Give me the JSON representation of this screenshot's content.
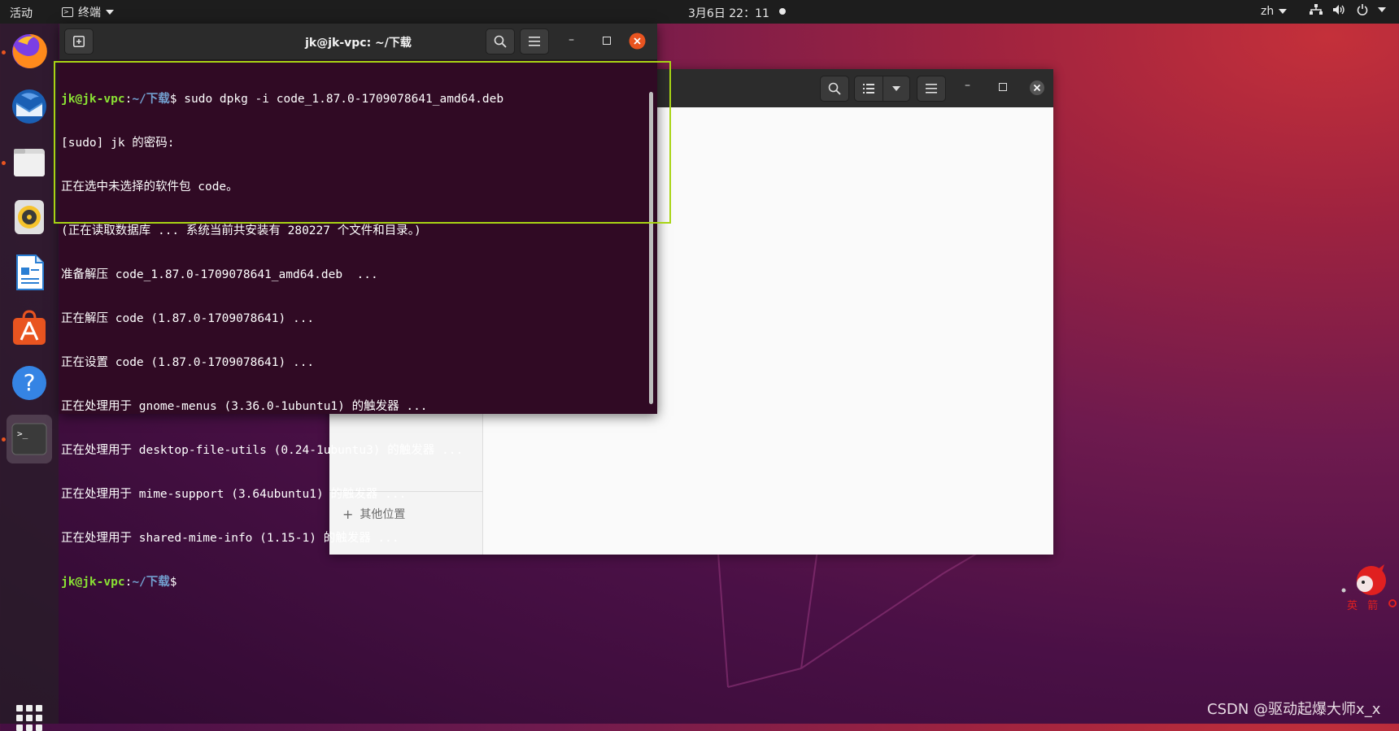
{
  "topbar": {
    "activities": "活动",
    "app_name": "终端",
    "clock": "3月6日  22：11",
    "language": "zh"
  },
  "dock": {
    "items": [
      {
        "name": "firefox",
        "running": true
      },
      {
        "name": "thunderbird",
        "running": false
      },
      {
        "name": "files",
        "running": true
      },
      {
        "name": "rhythmbox",
        "running": false
      },
      {
        "name": "libreoffice-writer",
        "running": false
      },
      {
        "name": "ubuntu-software",
        "running": false
      },
      {
        "name": "help",
        "running": false
      },
      {
        "name": "terminal",
        "running": true
      }
    ]
  },
  "terminal": {
    "title": "jk@jk-vpc: ~/下载",
    "prompt_user": "jk@jk-vpc",
    "prompt_path": "~/下载",
    "command": "sudo dpkg -i code_1.87.0-1709078641_amd64.deb",
    "output": [
      "[sudo] jk 的密码:",
      "正在选中未选择的软件包 code。",
      "(正在读取数据库 ... 系统当前共安装有 280227 个文件和目录。)",
      "准备解压 code_1.87.0-1709078641_amd64.deb  ...",
      "正在解压 code (1.87.0-1709078641) ...",
      "正在设置 code (1.87.0-1709078641) ...",
      "正在处理用于 gnome-menus (3.36.0-1ubuntu1) 的触发器 ...",
      "正在处理用于 desktop-file-utils (0.24-1ubuntu3) 的触发器 ...",
      "正在处理用于 mime-support (3.64ubuntu1) 的触发器 ...",
      "正在处理用于 shared-mime-info (1.15-1) 的触发器 ..."
    ]
  },
  "file_manager": {
    "other_locations": "其他位置"
  },
  "overlay": {
    "mascot_text": "英 箭",
    "watermark": "CSDN @驱动起爆大师x_x"
  },
  "colors": {
    "terminal_bg": "#300a24",
    "prompt_user": "#8ae234",
    "prompt_path": "#729fcf",
    "highlight_border": "#a8d414",
    "close_button": "#e95420"
  }
}
